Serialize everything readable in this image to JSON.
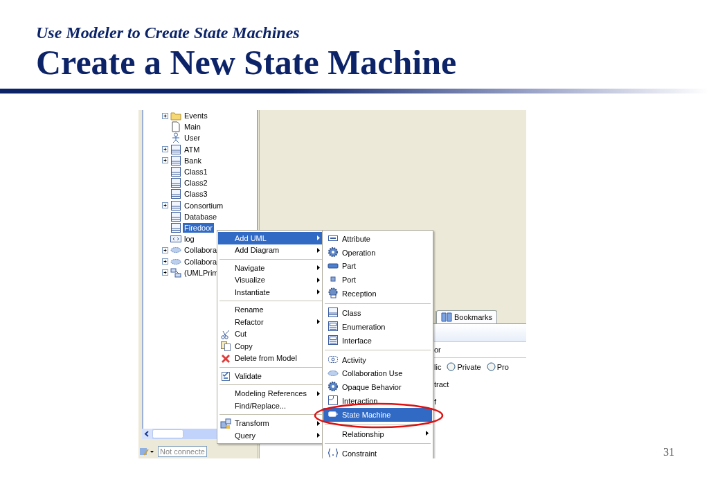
{
  "slide": {
    "subtitle": "Use Modeler to Create State Machines",
    "title": "Create a New State Machine",
    "page_number": "31"
  },
  "tree": {
    "items": [
      {
        "label": "Events",
        "kind": "folder",
        "expandable": true,
        "selected": false
      },
      {
        "label": "Main",
        "kind": "document",
        "expandable": false,
        "selected": false
      },
      {
        "label": "User",
        "kind": "actor",
        "expandable": false,
        "selected": false
      },
      {
        "label": "ATM",
        "kind": "class",
        "expandable": true,
        "selected": false
      },
      {
        "label": "Bank",
        "kind": "class",
        "expandable": true,
        "selected": false
      },
      {
        "label": "Class1",
        "kind": "class",
        "expandable": false,
        "selected": false
      },
      {
        "label": "Class2",
        "kind": "class",
        "expandable": false,
        "selected": false
      },
      {
        "label": "Class3",
        "kind": "class",
        "expandable": false,
        "selected": false
      },
      {
        "label": "Consortium",
        "kind": "class",
        "expandable": true,
        "selected": false
      },
      {
        "label": "Database",
        "kind": "class",
        "expandable": false,
        "selected": false
      },
      {
        "label": "Firedoor",
        "kind": "class",
        "expandable": false,
        "selected": true
      },
      {
        "label": "log",
        "kind": "signal",
        "expandable": false,
        "selected": false
      },
      {
        "label": "Collabora",
        "kind": "collaboration",
        "expandable": true,
        "selected": false
      },
      {
        "label": "Collabora",
        "kind": "collaboration",
        "expandable": true,
        "selected": false
      },
      {
        "label": "(UMLPrim",
        "kind": "template",
        "expandable": true,
        "selected": false
      }
    ]
  },
  "status_bar": {
    "connection_field": "Not connecte"
  },
  "properties": {
    "tabs": [
      {
        "label": "Bookmarks"
      }
    ],
    "rows": [
      {
        "kind": "field",
        "text": "or"
      },
      {
        "kind": "radios",
        "text": "lic",
        "options": [
          {
            "label": "Private",
            "checked": false
          },
          {
            "label": "Pro",
            "checked": false
          }
        ]
      },
      {
        "kind": "text",
        "text": "tract"
      },
      {
        "kind": "text",
        "text": "f"
      }
    ]
  },
  "context_menu": {
    "groups": [
      {
        "items": [
          {
            "label": "Add UML",
            "submenu": true,
            "selected": true
          },
          {
            "label": "Add Diagram",
            "submenu": true,
            "selected": false
          }
        ]
      },
      {
        "items": [
          {
            "label": "Navigate",
            "submenu": true,
            "selected": false
          },
          {
            "label": "Visualize",
            "submenu": true,
            "selected": false
          },
          {
            "label": "Instantiate",
            "submenu": true,
            "selected": false
          }
        ]
      },
      {
        "items": [
          {
            "label": "Rename",
            "submenu": false,
            "selected": false
          },
          {
            "label": "Refactor",
            "submenu": true,
            "selected": false
          },
          {
            "label": "Cut",
            "kind": "scissors",
            "submenu": false,
            "selected": false
          },
          {
            "label": "Copy",
            "kind": "copy",
            "submenu": false,
            "selected": false
          },
          {
            "label": "Delete from Model",
            "kind": "delete",
            "submenu": false,
            "selected": false
          }
        ]
      },
      {
        "items": [
          {
            "label": "Validate",
            "kind": "validate",
            "submenu": false,
            "selected": false
          }
        ]
      },
      {
        "items": [
          {
            "label": "Modeling References",
            "submenu": true,
            "selected": false
          },
          {
            "label": "Find/Replace...",
            "submenu": false,
            "selected": false
          }
        ]
      },
      {
        "items": [
          {
            "label": "Transform",
            "kind": "transform",
            "submenu": true,
            "selected": false
          },
          {
            "label": "Query",
            "submenu": true,
            "selected": false
          }
        ]
      }
    ]
  },
  "submenu": {
    "groups": [
      {
        "items": [
          {
            "label": "Attribute",
            "kind": "attribute",
            "submenu": false,
            "selected": false
          },
          {
            "label": "Operation",
            "kind": "operation",
            "submenu": false,
            "selected": false
          },
          {
            "label": "Part",
            "kind": "part",
            "submenu": false,
            "selected": false
          },
          {
            "label": "Port",
            "kind": "port",
            "submenu": false,
            "selected": false
          },
          {
            "label": "Reception",
            "kind": "reception",
            "submenu": false,
            "selected": false
          }
        ]
      },
      {
        "items": [
          {
            "label": "Class",
            "kind": "class",
            "submenu": false,
            "selected": false
          },
          {
            "label": "Enumeration",
            "kind": "enumeration",
            "submenu": false,
            "selected": false
          },
          {
            "label": "Interface",
            "kind": "interface",
            "submenu": false,
            "selected": false
          }
        ]
      },
      {
        "items": [
          {
            "label": "Activity",
            "kind": "activity",
            "submenu": false,
            "selected": false
          },
          {
            "label": "Collaboration Use",
            "kind": "collaboration",
            "submenu": false,
            "selected": false
          },
          {
            "label": "Opaque Behavior",
            "kind": "operation",
            "submenu": false,
            "selected": false
          },
          {
            "label": "Interaction",
            "kind": "interaction",
            "submenu": false,
            "selected": false
          },
          {
            "label": "State Machine",
            "kind": "statemachine",
            "submenu": false,
            "selected": true
          }
        ]
      },
      {
        "items": [
          {
            "label": "Relationship",
            "submenu": true,
            "selected": false
          }
        ]
      },
      {
        "items": [
          {
            "label": "Constraint",
            "kind": "constraint",
            "submenu": false,
            "selected": false
          }
        ]
      }
    ]
  }
}
